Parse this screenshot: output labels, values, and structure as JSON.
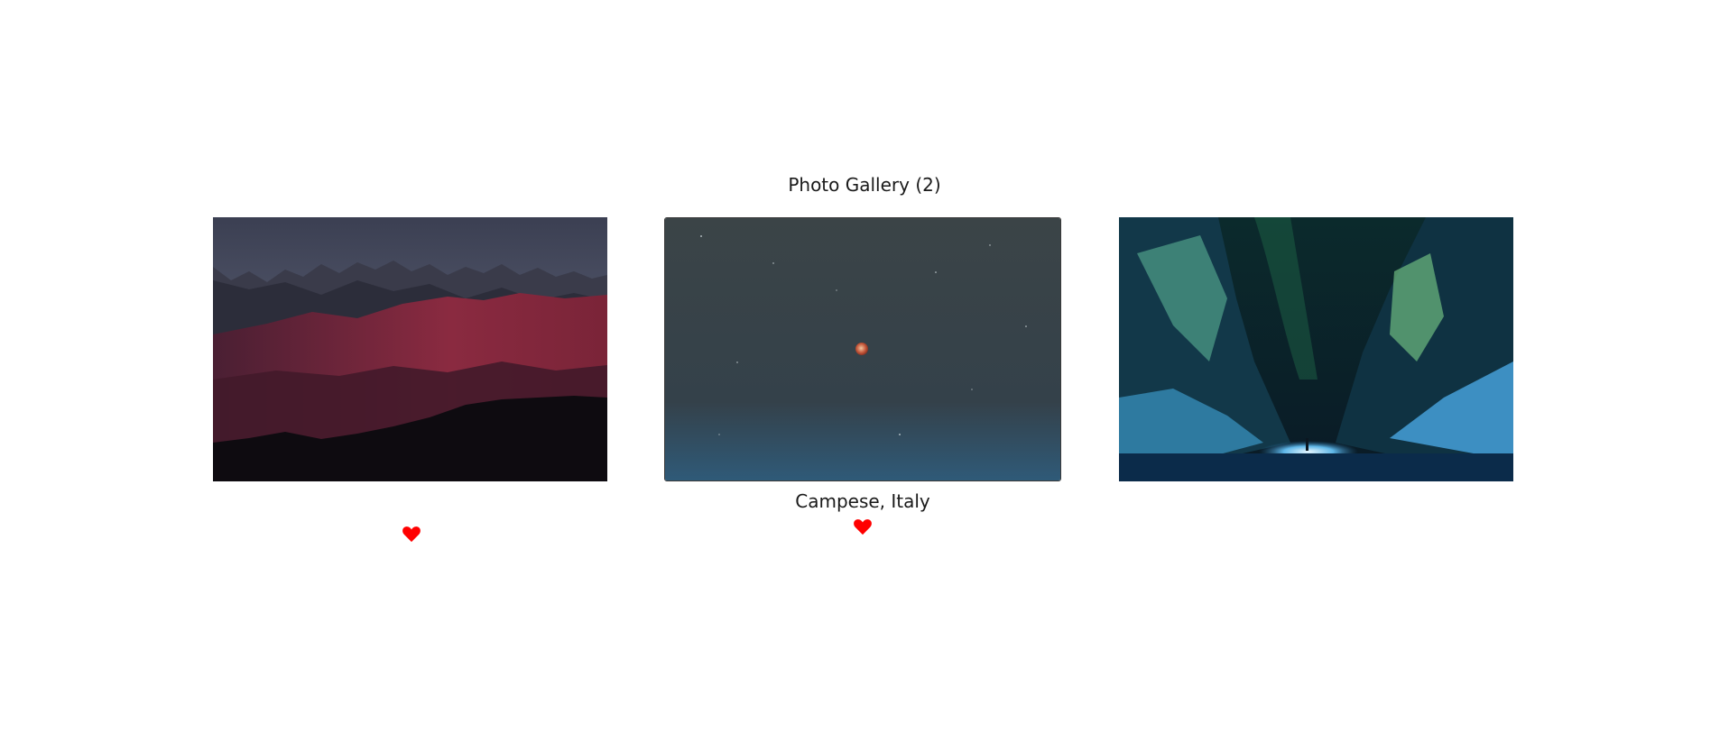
{
  "gallery": {
    "title": "Photo Gallery (2)"
  },
  "photos": [
    {
      "scene": "red mountains at dusk",
      "caption": "",
      "liked": true
    },
    {
      "scene": "moon in starry sky",
      "caption": "Campese, Italy",
      "liked": true
    },
    {
      "scene": "aurora over snowy canyon",
      "caption": "",
      "liked": false
    }
  ],
  "colors": {
    "heart": "#ff0000",
    "text": "#1a1a1a"
  },
  "icons": {
    "like": "heart-icon"
  }
}
